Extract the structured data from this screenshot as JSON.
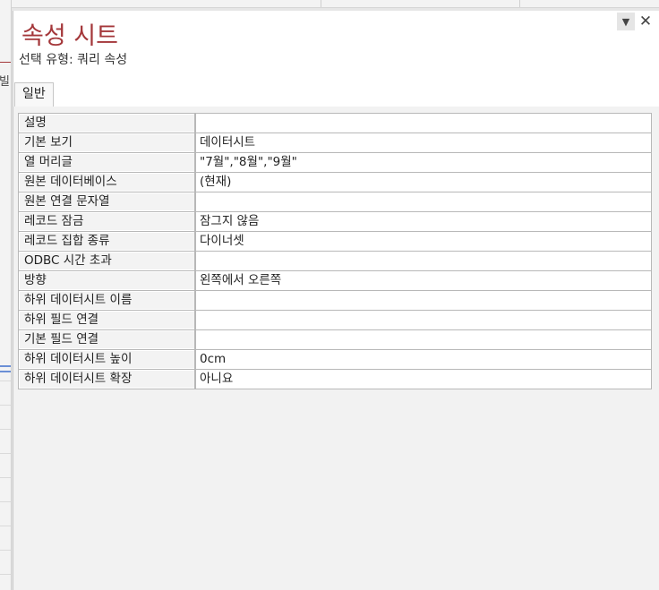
{
  "background": {
    "fragment_text": "빌"
  },
  "pane": {
    "title": "속성 시트",
    "subtitle": "선택 유형: 쿼리 속성",
    "menu_icon": "dropdown-arrow-icon",
    "close_icon": "close-icon",
    "tabs": [
      {
        "label": "일반",
        "selected": true
      }
    ],
    "properties": [
      {
        "label": "설명",
        "value": ""
      },
      {
        "label": "기본 보기",
        "value": "데이터시트"
      },
      {
        "label": "열 머리글",
        "value": "\"7월\",\"8월\",\"9월\""
      },
      {
        "label": "원본 데이터베이스",
        "value": "(현재)"
      },
      {
        "label": "원본 연결 문자열",
        "value": ""
      },
      {
        "label": "레코드 잠금",
        "value": "잠그지 않음"
      },
      {
        "label": "레코드 집합 종류",
        "value": "다이너셋"
      },
      {
        "label": "ODBC 시간 초과",
        "value": ""
      },
      {
        "label": "방향",
        "value": "왼쪽에서 오른쪽"
      },
      {
        "label": "하위 데이터시트 이름",
        "value": ""
      },
      {
        "label": "하위 필드 연결",
        "value": ""
      },
      {
        "label": "기본 필드 연결",
        "value": ""
      },
      {
        "label": "하위 데이터시트 높이",
        "value": "0cm"
      },
      {
        "label": "하위 데이터시트 확장",
        "value": "아니요"
      }
    ]
  },
  "colors": {
    "title": "#a4373a",
    "accent_blue": "#6b8fd6"
  }
}
